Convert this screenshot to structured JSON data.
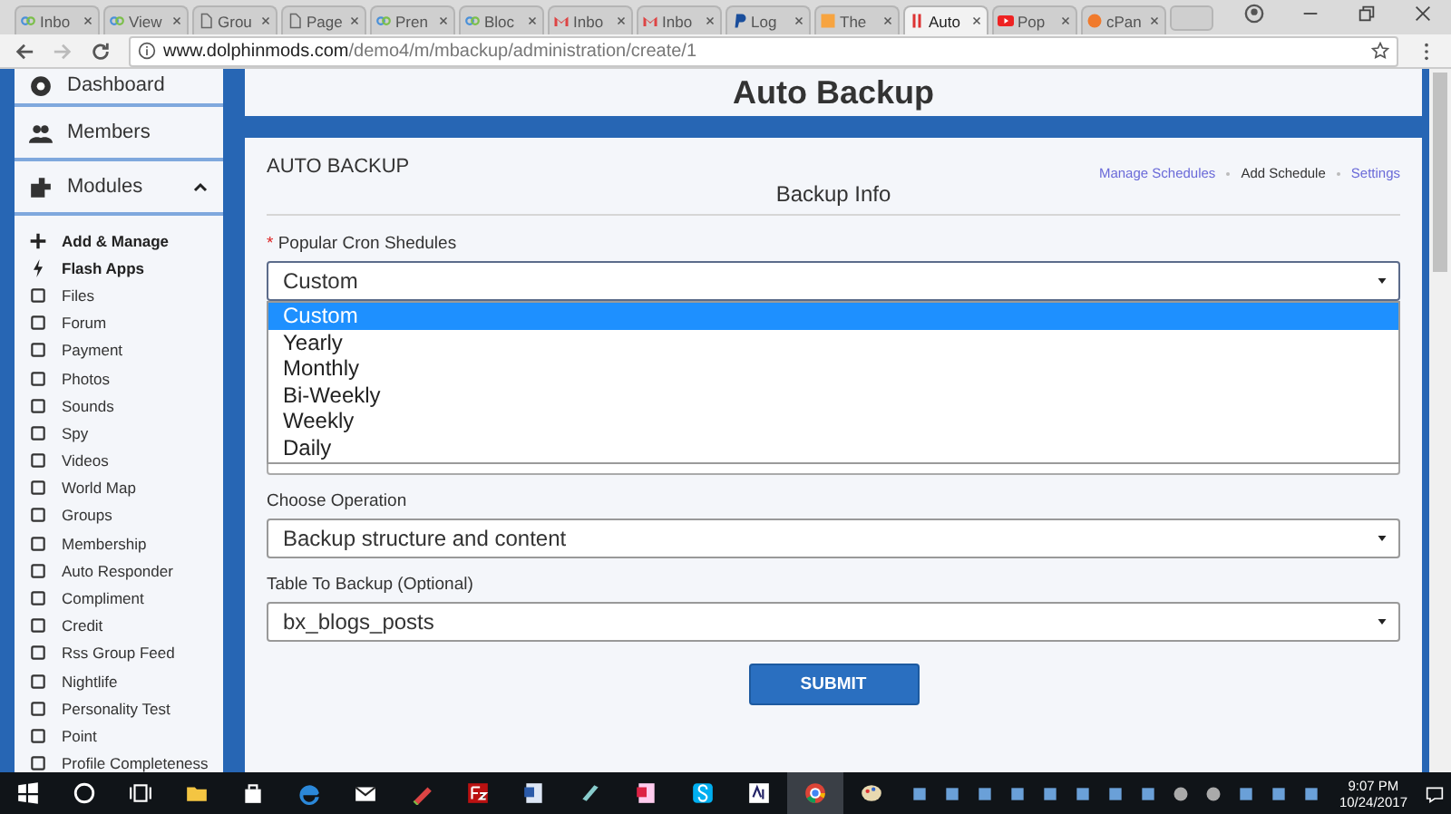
{
  "browser": {
    "tabs": [
      {
        "label": "Inbo",
        "selected": false
      },
      {
        "label": "View",
        "selected": false
      },
      {
        "label": "Grou",
        "selected": false
      },
      {
        "label": "Page",
        "selected": false
      },
      {
        "label": "Pren",
        "selected": false
      },
      {
        "label": "Bloc",
        "selected": false
      },
      {
        "label": "Inbo",
        "selected": false
      },
      {
        "label": "Inbo",
        "selected": false
      },
      {
        "label": "Log",
        "selected": false
      },
      {
        "label": "The",
        "selected": false
      },
      {
        "label": "Auto",
        "selected": true
      },
      {
        "label": "Pop",
        "selected": false
      },
      {
        "label": "cPan",
        "selected": false
      }
    ],
    "url_host": "www.dolphinmods.com",
    "url_path": "/demo4/m/mbackup/administration/create/1"
  },
  "sidebar": {
    "items": [
      {
        "label": "Dashboard"
      },
      {
        "label": "Members"
      },
      {
        "label": "Modules",
        "expanded": true,
        "children": [
          {
            "label": "Add & Manage",
            "bold": true
          },
          {
            "label": "Flash Apps",
            "bold": true
          },
          {
            "label": "Files",
            "bold": false
          },
          {
            "label": "Forum",
            "bold": false
          },
          {
            "label": "Payment",
            "bold": false
          },
          {
            "label": "Photos",
            "bold": false
          },
          {
            "label": "Sounds",
            "bold": false
          },
          {
            "label": "Spy",
            "bold": false
          },
          {
            "label": "Videos",
            "bold": false
          },
          {
            "label": "World Map",
            "bold": false
          },
          {
            "label": "Groups",
            "bold": false
          },
          {
            "label": "Membership",
            "bold": false
          },
          {
            "label": "Auto Responder",
            "bold": false
          },
          {
            "label": "Compliment",
            "bold": false
          },
          {
            "label": "Credit",
            "bold": false
          },
          {
            "label": "Rss Group Feed",
            "bold": false
          },
          {
            "label": "Nightlife",
            "bold": false
          },
          {
            "label": "Personality Test",
            "bold": false
          },
          {
            "label": "Point",
            "bold": false
          },
          {
            "label": "Profile Completeness",
            "bold": false
          }
        ]
      }
    ]
  },
  "page_title": "Auto Backup",
  "panel": {
    "title": "AUTO BACKUP",
    "links": [
      {
        "label": "Manage Schedules",
        "selected": false
      },
      {
        "label": "Add Schedule",
        "selected": true
      },
      {
        "label": "Settings",
        "selected": false
      }
    ],
    "section": "Backup Info",
    "fields": [
      {
        "label": "Popular Cron Shedules",
        "required_mark": "*",
        "value": "Custom",
        "expanded": true,
        "options": [
          {
            "label": "Custom",
            "selected": true
          },
          {
            "label": "Yearly",
            "selected": false
          },
          {
            "label": "Monthly",
            "selected": false
          },
          {
            "label": "Bi-Weekly",
            "selected": false
          },
          {
            "label": "Weekly",
            "selected": false
          },
          {
            "label": "Daily",
            "selected": false
          }
        ]
      },
      {
        "label": "Choose Operation",
        "value": "Backup structure and content",
        "expanded": false
      },
      {
        "label": "Table To Backup (Optional)",
        "value": "bx_blogs_posts",
        "expanded": false
      }
    ],
    "submit": "SUBMIT"
  },
  "taskbar": {
    "time": "9:07 PM",
    "date": "10/24/2017"
  }
}
